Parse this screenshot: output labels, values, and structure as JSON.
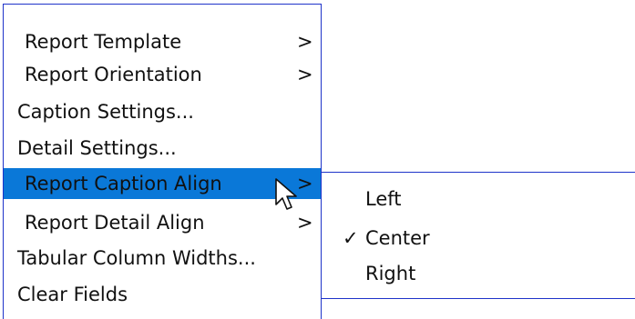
{
  "menu": {
    "items": [
      {
        "label": "Report Template",
        "arrow": ">"
      },
      {
        "label": "Report Orientation",
        "arrow": ">"
      },
      {
        "label": "Caption Settings...",
        "arrow": ""
      },
      {
        "label": "Detail Settings...",
        "arrow": ""
      },
      {
        "label": "Report Caption Align",
        "arrow": ">",
        "highlighted": true
      },
      {
        "label": "Report Detail Align",
        "arrow": ">"
      },
      {
        "label": "Tabular Column Widths...",
        "arrow": ""
      },
      {
        "label": "Clear Fields",
        "arrow": ""
      }
    ]
  },
  "submenu": {
    "items": [
      {
        "label": "Left",
        "check": ""
      },
      {
        "label": "Center",
        "check": "✓",
        "selected": true
      },
      {
        "label": "Right",
        "check": ""
      }
    ]
  },
  "colors": {
    "highlight": "#0a78d8",
    "border": "#1e33c9",
    "text": "#111111"
  },
  "icons": {
    "cursor": "arrow-cursor-icon",
    "check": "check-icon",
    "submenu_arrow": "chevron-right-icon"
  }
}
